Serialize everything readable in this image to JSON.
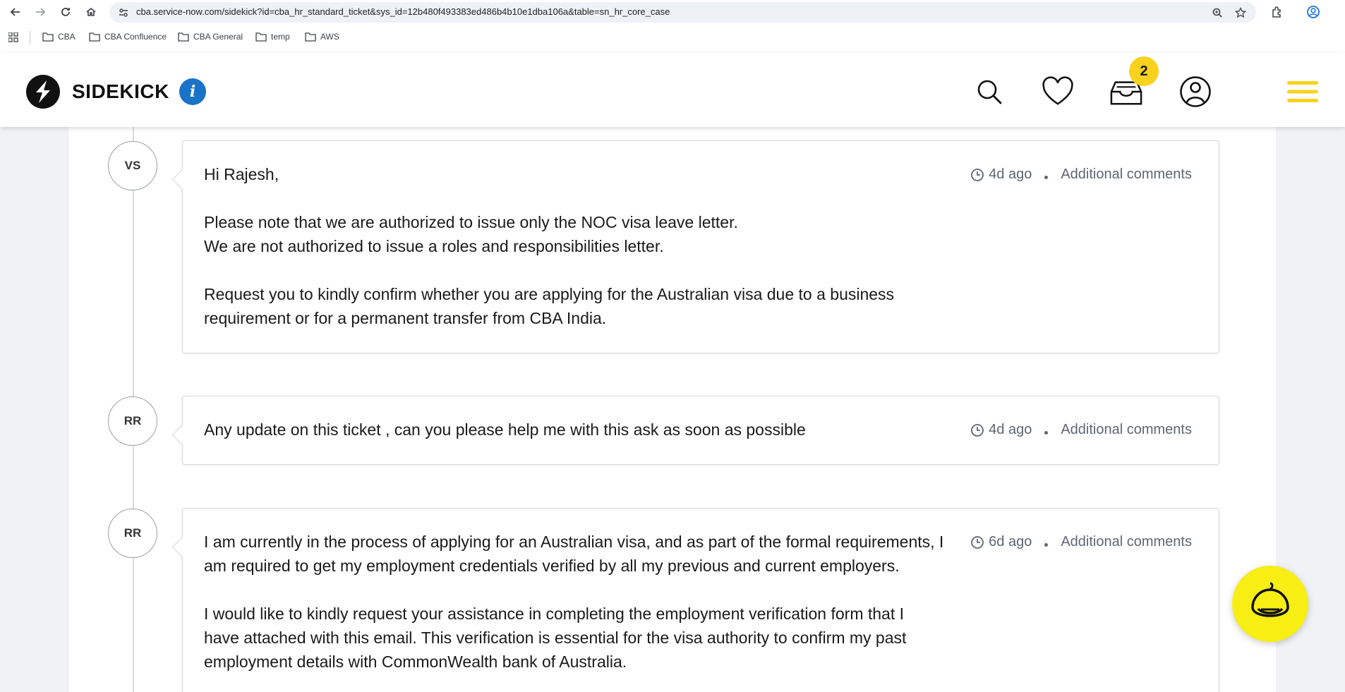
{
  "browser": {
    "url": "cba.service-now.com/sidekick?id=cba_hr_standard_ticket&sys_id=12b480f493383ed486b4b10e1dba106a&table=sn_hr_core_case",
    "bookmarks": [
      "CBA",
      "CBA Confluence",
      "CBA General",
      "temp",
      "AWS"
    ]
  },
  "header": {
    "logo_text": "SIDEKICK",
    "info_label": "i",
    "cart_count": "2"
  },
  "comments": [
    {
      "avatar": "VS",
      "time": "4d ago",
      "type": "Additional comments",
      "paragraphs": [
        [
          "Hi Rajesh,"
        ],
        [
          "Please note that we are authorized to issue only the NOC visa leave letter.",
          "We are not authorized to issue a roles and responsibilities letter."
        ],
        [
          "Request you to kindly confirm whether you are applying for the Australian visa due to a business",
          "requirement or for a permanent transfer from CBA India."
        ]
      ]
    },
    {
      "avatar": "RR",
      "time": "4d ago",
      "type": "Additional comments",
      "paragraphs": [
        [
          "Any update on this ticket , can you please help me with this ask as soon as possible"
        ]
      ]
    },
    {
      "avatar": "RR",
      "time": "6d ago",
      "type": "Additional comments",
      "paragraphs": [
        [
          "I am currently in the process of applying for an Australian visa, and as part of the formal requirements, I",
          "am required to get my employment credentials verified by all my previous and current employers."
        ],
        [
          "I would like to kindly request your assistance in completing the employment verification form that I",
          "have attached with this email. This verification is essential for the visa authority to confirm my past",
          "employment details with CommonWealth bank of Australia."
        ]
      ]
    }
  ],
  "colors": {
    "accent_yellow": "#f8d21c",
    "info_blue": "#1a73c8",
    "bot_yellow": "#f7ee14"
  }
}
